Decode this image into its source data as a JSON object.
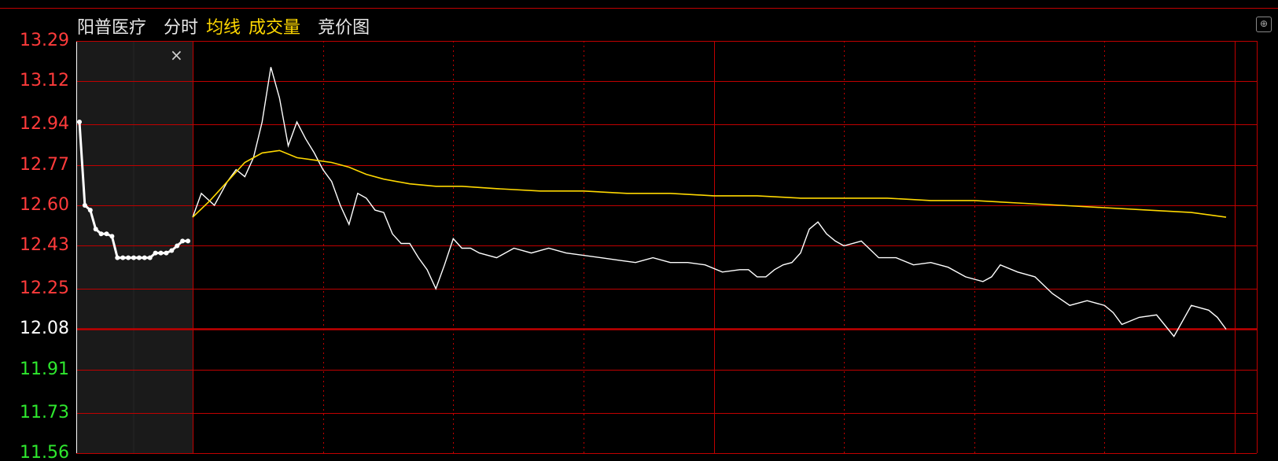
{
  "header": {
    "stock_name": "阳普医疗",
    "tabs": [
      {
        "label": "分时",
        "color": "#e8e8e8"
      },
      {
        "label": "均线",
        "color": "#ffd800"
      },
      {
        "label": "成交量",
        "color": "#ffd800"
      },
      {
        "label": "竞价图",
        "color": "#e8e8e8"
      }
    ]
  },
  "colors": {
    "background": "#000000",
    "grid": "#c00000",
    "price_line": "#ffffff",
    "avg_line": "#ffd800",
    "up": "#ff3b3b",
    "down": "#2ee82e",
    "auction_bg": "#1a1a1a"
  },
  "icons": {
    "close": "×",
    "expand": "⊕"
  },
  "chart_data": {
    "type": "line",
    "prev_close": 12.08,
    "ylim": [
      11.56,
      13.29
    ],
    "y_ticks": [
      {
        "label": "13.29",
        "value": 13.29,
        "dir": "up"
      },
      {
        "label": "13.12",
        "value": 13.12,
        "dir": "up"
      },
      {
        "label": "12.94",
        "value": 12.94,
        "dir": "up"
      },
      {
        "label": "12.77",
        "value": 12.77,
        "dir": "up"
      },
      {
        "label": "12.60",
        "value": 12.6,
        "dir": "up"
      },
      {
        "label": "12.43",
        "value": 12.43,
        "dir": "up"
      },
      {
        "label": "12.25",
        "value": 12.25,
        "dir": "up"
      },
      {
        "label": "12.08",
        "value": 12.08,
        "dir": "flat"
      },
      {
        "label": "11.91",
        "value": 11.91,
        "dir": "down"
      },
      {
        "label": "11.73",
        "value": 11.73,
        "dir": "down"
      },
      {
        "label": "11.56",
        "value": 11.56,
        "dir": "down"
      }
    ],
    "x_range": [
      0,
      240
    ],
    "auction": [
      12.95,
      12.6,
      12.58,
      12.5,
      12.48,
      12.48,
      12.47,
      12.38,
      12.38,
      12.38,
      12.38,
      12.38,
      12.38,
      12.38,
      12.4,
      12.4,
      12.4,
      12.41,
      12.43,
      12.45,
      12.45
    ],
    "series": [
      {
        "role": "price",
        "x": [
          0,
          2,
          5,
          8,
          10,
          12,
          14,
          16,
          18,
          20,
          22,
          24,
          26,
          28,
          30,
          32,
          34,
          36,
          38,
          40,
          42,
          44,
          46,
          48,
          50,
          52,
          54,
          56,
          58,
          60,
          62,
          64,
          66,
          70,
          74,
          78,
          82,
          86,
          90,
          94,
          98,
          102,
          106,
          110,
          114,
          118,
          122,
          126,
          128,
          130,
          132,
          134,
          136,
          138,
          140,
          142,
          144,
          146,
          148,
          150,
          154,
          158,
          162,
          166,
          170,
          174,
          178,
          182,
          184,
          186,
          190,
          194,
          198,
          202,
          206,
          210,
          212,
          214,
          218,
          222,
          226,
          230,
          234,
          236,
          238
        ],
        "values": [
          12.55,
          12.65,
          12.6,
          12.7,
          12.75,
          12.72,
          12.8,
          12.95,
          13.18,
          13.05,
          12.85,
          12.95,
          12.88,
          12.82,
          12.75,
          12.7,
          12.6,
          12.52,
          12.65,
          12.63,
          12.58,
          12.57,
          12.48,
          12.44,
          12.44,
          12.38,
          12.33,
          12.25,
          12.35,
          12.46,
          12.42,
          12.42,
          12.4,
          12.38,
          12.42,
          12.4,
          12.42,
          12.4,
          12.39,
          12.38,
          12.37,
          12.36,
          12.38,
          12.36,
          12.36,
          12.35,
          12.32,
          12.33,
          12.33,
          12.3,
          12.3,
          12.33,
          12.35,
          12.36,
          12.4,
          12.5,
          12.53,
          12.48,
          12.45,
          12.43,
          12.45,
          12.38,
          12.38,
          12.35,
          12.36,
          12.34,
          12.3,
          12.28,
          12.3,
          12.35,
          12.32,
          12.3,
          12.23,
          12.18,
          12.2,
          12.18,
          12.15,
          12.1,
          12.13,
          12.14,
          12.05,
          12.18,
          12.16,
          12.13,
          12.08
        ]
      },
      {
        "role": "average",
        "x": [
          0,
          4,
          8,
          12,
          16,
          20,
          24,
          28,
          32,
          36,
          40,
          44,
          50,
          56,
          62,
          70,
          80,
          90,
          100,
          110,
          120,
          130,
          140,
          150,
          160,
          170,
          180,
          190,
          200,
          210,
          220,
          230,
          238
        ],
        "values": [
          12.55,
          12.62,
          12.7,
          12.78,
          12.82,
          12.83,
          12.8,
          12.79,
          12.78,
          12.76,
          12.73,
          12.71,
          12.69,
          12.68,
          12.68,
          12.67,
          12.66,
          12.66,
          12.65,
          12.65,
          12.64,
          12.64,
          12.63,
          12.63,
          12.63,
          12.62,
          12.62,
          12.61,
          12.6,
          12.59,
          12.58,
          12.57,
          12.55
        ]
      }
    ]
  }
}
